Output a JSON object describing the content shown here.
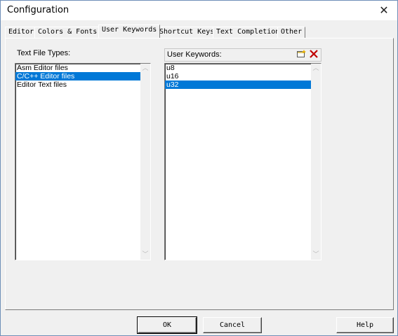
{
  "window": {
    "title": "Configuration"
  },
  "tabs": [
    {
      "label": "Editor"
    },
    {
      "label": "Colors & Fonts"
    },
    {
      "label": "User Keywords"
    },
    {
      "label": "Shortcut Keys"
    },
    {
      "label": "Text Completion"
    },
    {
      "label": "Other"
    }
  ],
  "active_tab": "User Keywords",
  "file_types": {
    "label": "Text File Types:",
    "items": [
      "Asm Editor files",
      "C/C++ Editor files",
      "Editor Text files"
    ],
    "selected": "C/C++ Editor files"
  },
  "keywords": {
    "label": "User Keywords:",
    "items": [
      "u8",
      "u16",
      "u32"
    ],
    "selected": "u32",
    "new_icon": "new-item-icon",
    "delete_icon": "delete-icon"
  },
  "buttons": {
    "ok": "OK",
    "cancel": "Cancel",
    "help": "Help"
  }
}
